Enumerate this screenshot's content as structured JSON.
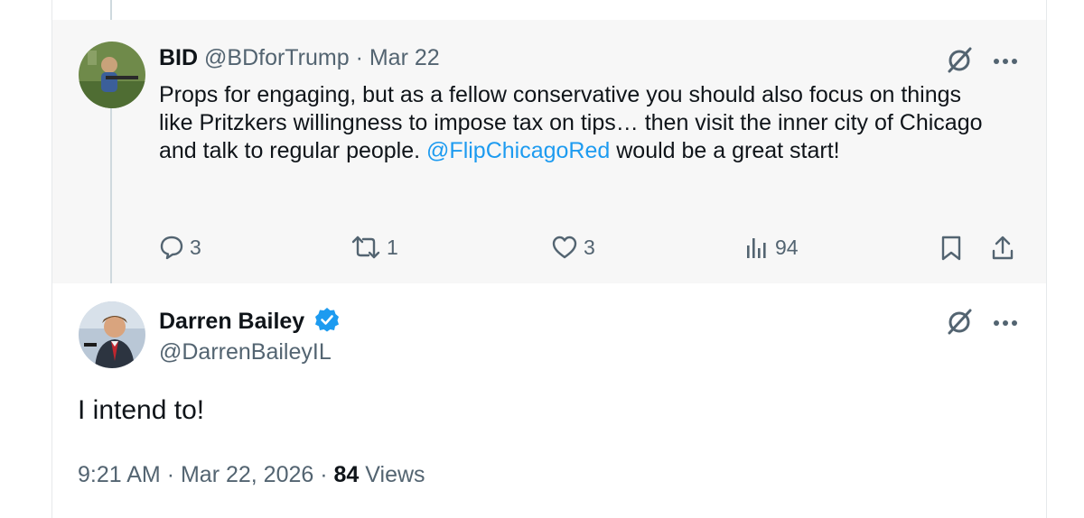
{
  "reply": {
    "display_name": "BID",
    "handle": "@BDforTrump",
    "separator": "·",
    "date": "Mar 22",
    "text_before": "Props for engaging, but as a fellow conservative you should also focus on things like Pritzkers willingness to impose tax on tips… then visit the inner city of Chicago and talk to regular people.",
    "mention": "@FlipChicagoRed",
    "text_after": "would be a great start!",
    "actions": {
      "replies": "3",
      "reposts": "1",
      "likes": "3",
      "views": "94"
    }
  },
  "main": {
    "display_name": "Darren Bailey",
    "handle": "@DarrenBaileyIL",
    "text": "I intend to!",
    "time": "9:21 AM",
    "separator": "·",
    "date": "Mar 22, 2026",
    "separator2": "·",
    "views_count": "84",
    "views_label": "Views"
  },
  "icons": {
    "grok": "grok-slash-icon",
    "more": "more-dots-icon",
    "reply": "reply-bubble-icon",
    "repost": "repost-icon",
    "like": "heart-icon",
    "views": "bar-chart-icon",
    "bookmark": "bookmark-icon",
    "share": "share-upload-icon",
    "verified": "verified-badge-icon"
  },
  "colors": {
    "accent": "#1d9bf0",
    "muted": "#536471",
    "text": "#0f1419"
  }
}
